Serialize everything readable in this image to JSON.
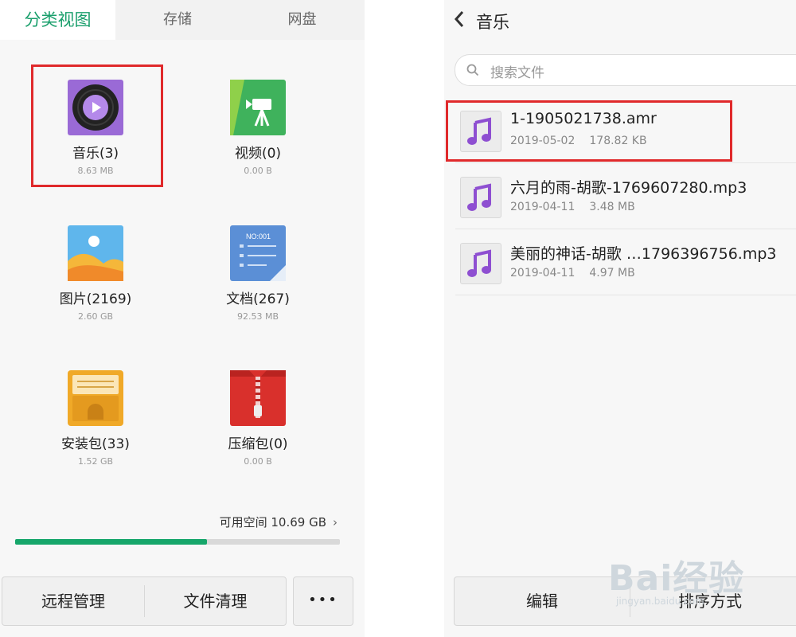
{
  "left": {
    "tabs": [
      {
        "label": "分类视图",
        "active": true
      },
      {
        "label": "存储",
        "active": false
      },
      {
        "label": "网盘",
        "active": false
      }
    ],
    "categories": [
      {
        "label": "音乐(3)",
        "size": "8.63 MB",
        "icon": "music-disc-icon"
      },
      {
        "label": "视频(0)",
        "size": "0.00 B",
        "icon": "video-camera-icon"
      },
      {
        "label": "图片(2169)",
        "size": "2.60 GB",
        "icon": "picture-icon"
      },
      {
        "label": "文档(267)",
        "size": "92.53 MB",
        "icon": "document-icon",
        "doc_tag": "NO:001"
      },
      {
        "label": "安装包(33)",
        "size": "1.52 GB",
        "icon": "apk-package-icon"
      },
      {
        "label": "压缩包(0)",
        "size": "0.00 B",
        "icon": "zip-archive-icon"
      }
    ],
    "storage": {
      "free_label": "可用空间 10.69 GB",
      "used_fraction": 0.59
    },
    "bottom": {
      "remote": "远程管理",
      "clean": "文件清理",
      "more": "•••"
    },
    "colors": {
      "accent": "#1a9f6c",
      "progress": "#16a66a",
      "highlight": "#e0292b"
    }
  },
  "right": {
    "title": "音乐",
    "search_placeholder": "搜索文件",
    "files": [
      {
        "name": "1-1905021738.amr",
        "date": "2019-05-02",
        "size": "178.82 KB"
      },
      {
        "name": "六月的雨-胡歌-1769607280.mp3",
        "date": "2019-04-11",
        "size": "3.48 MB"
      },
      {
        "name": "美丽的神话-胡歌 …1796396756.mp3",
        "date": "2019-04-11",
        "size": "4.97 MB"
      }
    ],
    "bottom": {
      "edit": "编辑",
      "sort": "排序方式"
    }
  },
  "watermark": {
    "brand": "Bai经验",
    "url": "jingyan.baidu.com"
  }
}
